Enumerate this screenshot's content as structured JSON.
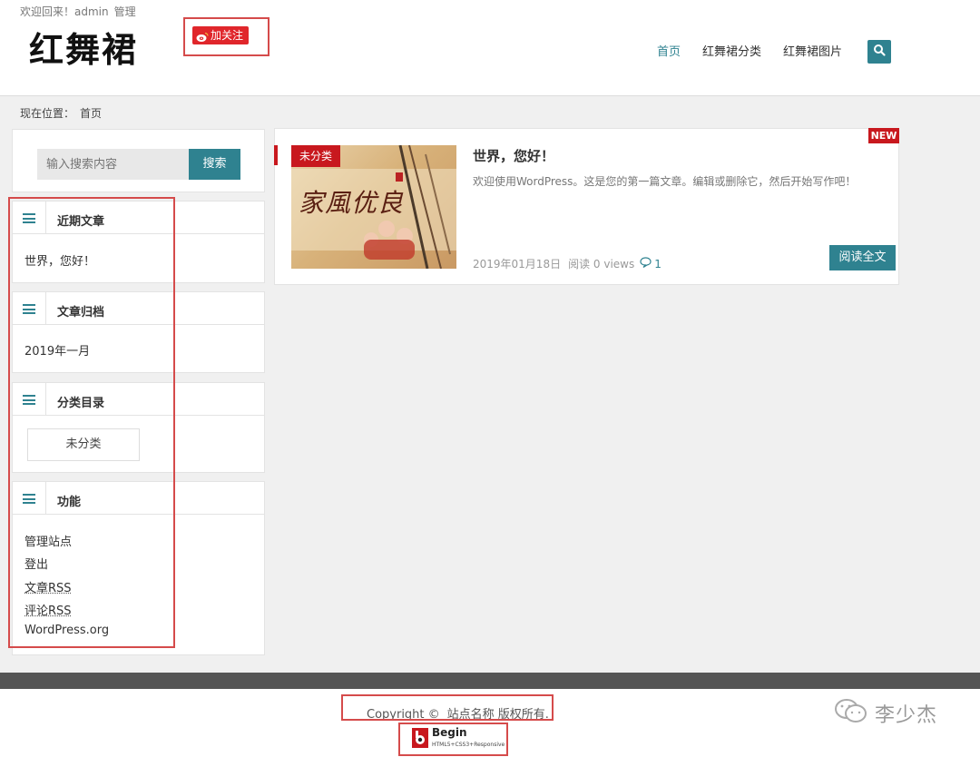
{
  "header": {
    "welcome_text": "欢迎回来！admin",
    "admin_link": "管理",
    "logo_text": "红舞裙",
    "follow_label": "加关注",
    "nav": [
      "首页",
      "红舞裙分类",
      "红舞裙图片"
    ],
    "search_icon": "search-icon",
    "accent_color": "#2f8290"
  },
  "breadcrumb": {
    "label": "现在位置：",
    "current": "首页"
  },
  "sidebar": {
    "search_placeholder": "输入搜索内容",
    "search_button": "搜索",
    "widgets": [
      {
        "title": "近期文章",
        "items": [
          "世界，您好！"
        ]
      },
      {
        "title": "文章归档",
        "items": [
          "2019年一月"
        ]
      },
      {
        "title": "分类目录",
        "items": [
          "未分类"
        ]
      },
      {
        "title": "功能",
        "items": [
          "管理站点",
          "登出",
          "文章RSS",
          "评论RSS",
          "WordPress.org"
        ]
      }
    ]
  },
  "post": {
    "badge": "NEW",
    "category": "未分类",
    "thumb_text": "家風优良",
    "title": "世界，您好！",
    "excerpt": "欢迎使用WordPress。这是您的第一篇文章。编辑或删除它，然后开始写作吧！",
    "date": "2019年01月18日",
    "views": "阅读 0 views",
    "comments": "1",
    "read_more": "阅读全文",
    "category_color": "#c8181e"
  },
  "footer": {
    "copyright": "Copyright ©",
    "site_name": "站点名称  版权所有.",
    "begin_title": "Begin",
    "begin_sub": "HTML5+CSS3+Responsive"
  },
  "watermark": {
    "text": "李少杰"
  }
}
